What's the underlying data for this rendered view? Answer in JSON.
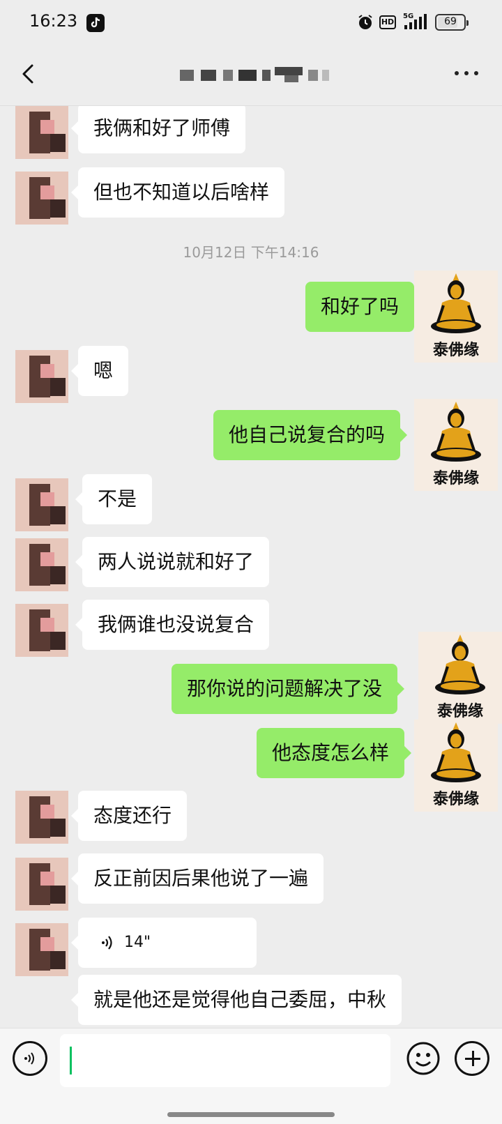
{
  "status_bar": {
    "time": "16:23",
    "hd_label": "HD",
    "network": "5G",
    "battery": 69,
    "battery_text": "69"
  },
  "header": {
    "back_icon": "chevron-left-icon",
    "title_icon": "pixelated-contact-name",
    "more_icon": "more-dots-icon"
  },
  "contact": {
    "avatar": "pixelated-avatar-icon"
  },
  "me": {
    "avatar_label": "泰佛缘",
    "avatar_icon": "buddha-icon"
  },
  "messages": {
    "m1": "我俩和好了师傅",
    "m2": "但也不知道以后啥样",
    "timestamp": "10月12日 下午14:16",
    "m3": "和好了吗",
    "m4": "嗯",
    "m5": "他自己说复合的吗",
    "m6": "不是",
    "m7": "两人说说就和好了",
    "m8": "我俩谁也没说复合",
    "m9": "那你说的问题解决了没",
    "m10": "他态度怎么样",
    "m11": "态度还行",
    "m12": "反正前因后果他说了一遍",
    "voice_duration": "14\"",
    "m13": "就是他还是觉得他自己委屈，中秋"
  },
  "input_bar": {
    "voice_icon": "voice-input-icon",
    "input_value": "",
    "emoji_icon": "emoji-icon",
    "plus_icon": "plus-icon"
  },
  "colors": {
    "background": "#ededed",
    "incoming_bubble": "#ffffff",
    "outgoing_bubble": "#95ec69",
    "caret": "#07c160"
  }
}
